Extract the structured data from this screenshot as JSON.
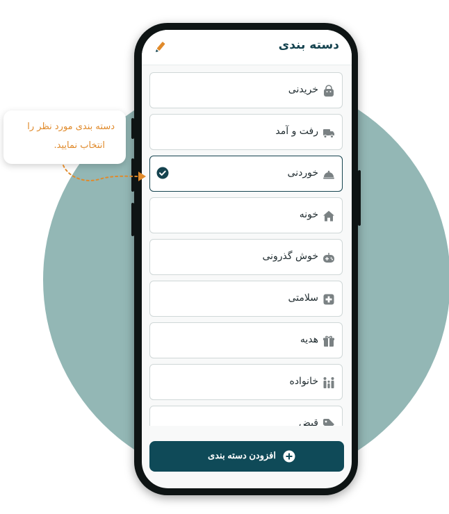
{
  "header": {
    "title": "دسته بندی",
    "edit_icon": "pencil-icon"
  },
  "categories": [
    {
      "label": "خریدنی",
      "icon": "shopping-bag-icon",
      "selected": false
    },
    {
      "label": "رفت و آمد",
      "icon": "truck-icon",
      "selected": false
    },
    {
      "label": "خوردنی",
      "icon": "food-cloche-icon",
      "selected": true
    },
    {
      "label": "خونه",
      "icon": "home-icon",
      "selected": false
    },
    {
      "label": "خوش گذرونی",
      "icon": "gamepad-icon",
      "selected": false
    },
    {
      "label": "سلامتی",
      "icon": "medical-plus-icon",
      "selected": false
    },
    {
      "label": "هدیه",
      "icon": "gift-icon",
      "selected": false
    },
    {
      "label": "خانواده",
      "icon": "family-icon",
      "selected": false
    },
    {
      "label": "قبض",
      "icon": "tag-icon",
      "selected": false
    }
  ],
  "add_button": {
    "label": "افزودن دسته بندی",
    "icon": "plus-circle-icon"
  },
  "tooltip": {
    "line1": "دسته بندی مورد نظر را",
    "line2": "انتخاب نمایید."
  },
  "colors": {
    "primary": "#0f4a58",
    "accent": "#e08a2b",
    "background_circle": "#93b7b5"
  }
}
